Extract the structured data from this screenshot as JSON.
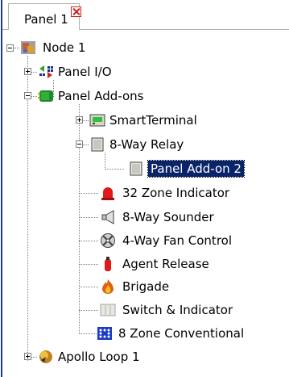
{
  "tab": {
    "label": "Panel 1"
  },
  "tree": {
    "node1": "Node 1",
    "panel_io": "Panel I/O",
    "panel_addons": "Panel Add-ons",
    "smartterminal": "SmartTerminal",
    "relay8": "8-Way Relay",
    "panel_addon2": "Panel Add-on 2",
    "zone_indicator": "32 Zone Indicator",
    "sounder": "8-Way Sounder",
    "fan_control": "4-Way Fan Control",
    "agent_release": "Agent Release",
    "brigade": "Brigade",
    "switch_indicator": "Switch & Indicator",
    "zone_conventional": "8 Zone Conventional",
    "apollo_loop": "Apollo Loop 1"
  },
  "colors": {
    "selection": "#0a246a"
  }
}
